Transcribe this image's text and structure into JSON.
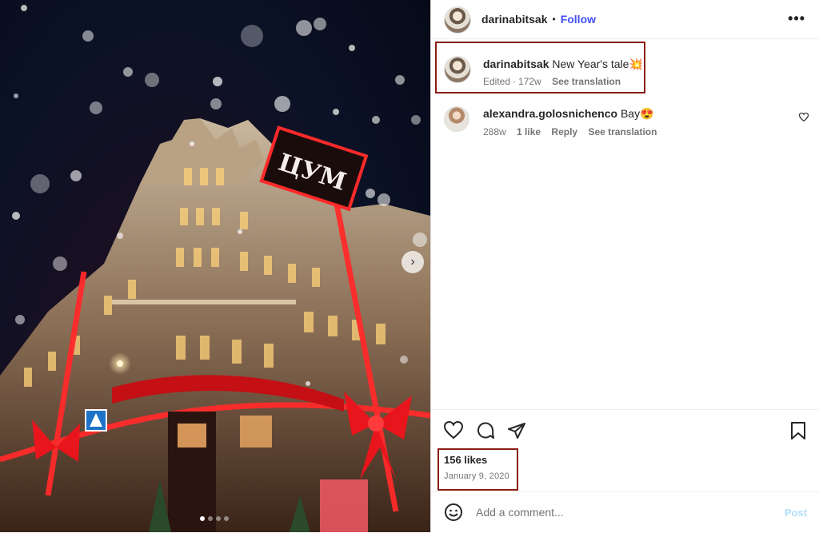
{
  "post": {
    "author": "darinabitsak",
    "separator": "•",
    "follow_label": "Follow",
    "more_icon": "more-horizontal-icon",
    "caption": {
      "username": "darinabitsak",
      "text": "New Year's tale",
      "emoji": "💥",
      "edited": "Edited",
      "dot": "·",
      "age": "172w",
      "translate": "See translation"
    },
    "comments": [
      {
        "username": "alexandra.golosnichenco",
        "text": "Bay",
        "emoji": "😍",
        "age": "288w",
        "likes": "1 like",
        "reply": "Reply",
        "translate": "See translation"
      }
    ],
    "likes": "156 likes",
    "date": "January 9, 2020"
  },
  "composer": {
    "placeholder": "Add a comment...",
    "post_label": "Post"
  },
  "carousel": {
    "next_glyph": "›",
    "dots": 4,
    "active_dot": 0
  },
  "colors": {
    "accent": "#4150f7",
    "highlight_box": "#8b1c12",
    "post_disabled": "#b2dffc",
    "neon_red": "#ff2a2a"
  },
  "photo": {
    "sign_text": "ЦУМ"
  }
}
